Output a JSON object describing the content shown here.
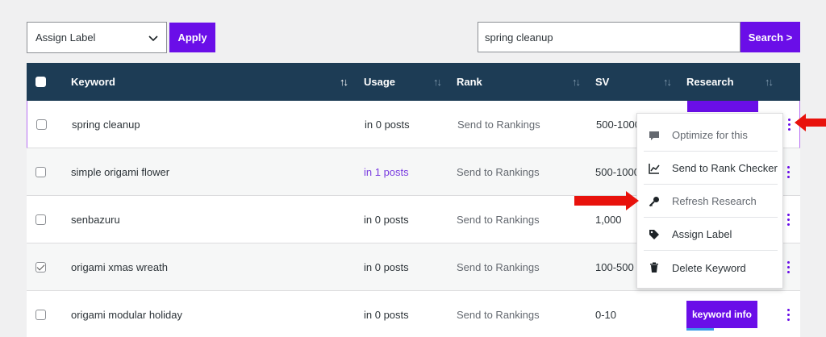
{
  "toolbar": {
    "bulk_select": "Assign Label",
    "apply_label": "Apply",
    "search_value": "spring cleanup",
    "search_label": "Search >"
  },
  "table": {
    "columns": [
      "Keyword",
      "Usage",
      "Rank",
      "SV",
      "Research"
    ],
    "rows": [
      {
        "keyword": "spring cleanup",
        "usage": "in 0 posts",
        "rank": "Send to Rankings",
        "sv": "500-1000",
        "checked": false
      },
      {
        "keyword": "simple origami flower",
        "usage": "in 1 posts",
        "rank": "Send to Rankings",
        "sv": "500-1000",
        "checked": false
      },
      {
        "keyword": "senbazuru",
        "usage": "in 0 posts",
        "rank": "Send to Rankings",
        "sv": "1,000",
        "checked": false
      },
      {
        "keyword": "origami xmas wreath",
        "usage": "in 0 posts",
        "rank": "Send to Rankings",
        "sv": "100-500",
        "checked": true
      },
      {
        "keyword": "origami modular holiday",
        "usage": "in 0 posts",
        "rank": "Send to Rankings",
        "sv": "0-10",
        "checked": false
      }
    ],
    "keyword_info_label": "keyword info"
  },
  "menu": {
    "items": [
      {
        "label": "Optimize for this",
        "icon": "comment-icon"
      },
      {
        "label": "Send to Rank Checker",
        "icon": "chart-line-icon"
      },
      {
        "label": "Refresh Research",
        "icon": "key-icon"
      },
      {
        "label": "Assign Label",
        "icon": "tag-icon"
      },
      {
        "label": "Delete Keyword",
        "icon": "trash-icon"
      }
    ]
  },
  "colors": {
    "accent": "#6a0ee8",
    "header": "#1d3c55",
    "arrow": "#e8120c"
  }
}
